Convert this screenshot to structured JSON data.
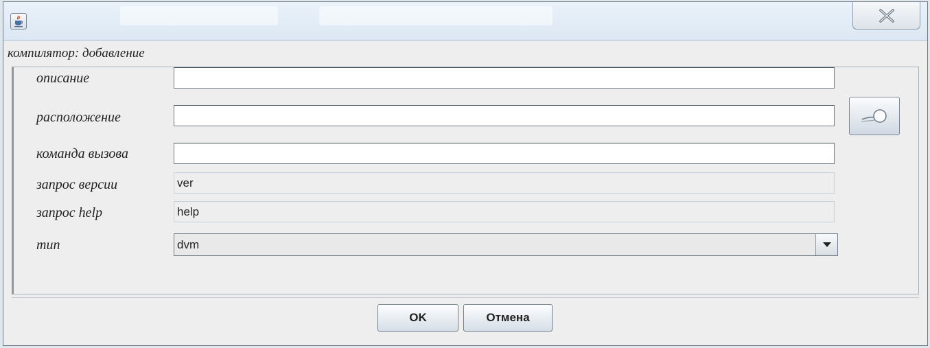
{
  "window": {
    "close_icon": "close-icon",
    "app_icon": "java-icon"
  },
  "panel": {
    "title": "компилятор: добавление"
  },
  "fields": {
    "description": {
      "label": "описание",
      "value": ""
    },
    "location": {
      "label": "расположение",
      "value": ""
    },
    "command": {
      "label": "команда вызова",
      "value": ""
    },
    "version_query": {
      "label": "запрос версии",
      "value": "ver"
    },
    "help_query": {
      "label": "запрос help",
      "value": "help"
    },
    "type": {
      "label": "тип",
      "value": "dvm"
    }
  },
  "buttons": {
    "ok": "OK",
    "cancel": "Отмена",
    "browse_icon": "browse-icon"
  }
}
